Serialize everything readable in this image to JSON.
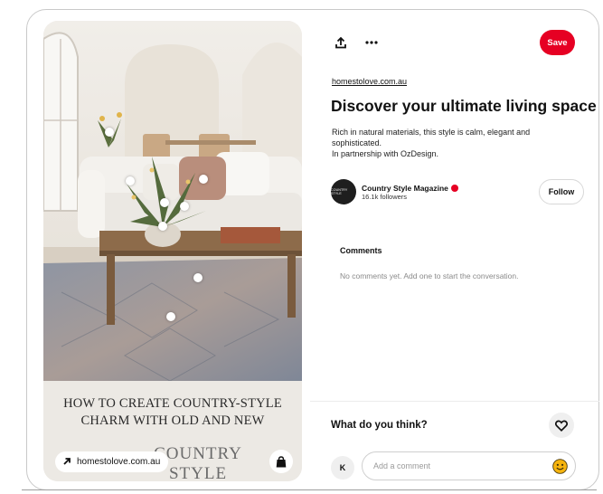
{
  "pin": {
    "headline": "HOW TO CREATE COUNTRY-STYLE CHARM WITH OLD AND NEW",
    "brand_logo_text": "COUNTRY STYLE",
    "link_text": "homestolove.com.au",
    "link_icon": "arrow-up-right-icon",
    "shop_icon": "shopping-bag-icon"
  },
  "toolbar": {
    "share_icon": "share-icon",
    "more_icon": "more-icon",
    "save_label": "Save"
  },
  "source_link": "homestolove.com.au",
  "title": "Discover your ultimate living space",
  "description_lines": [
    "Rich in natural materials, this style is calm, elegant and sophisticated.",
    "In partnership with OzDesign."
  ],
  "profile": {
    "avatar_text": "COUNTRY STYLE",
    "name": "Country Style Magazine",
    "followers": "16.1k followers",
    "follow_label": "Follow"
  },
  "comments": {
    "title": "Comments",
    "empty_text": "No comments yet. Add one to start the conversation."
  },
  "composer": {
    "prompt": "What do you think?",
    "heart_icon": "heart-icon",
    "user_initial": "K",
    "placeholder": "Add a comment",
    "emoji_icon": "smiley-icon"
  },
  "colors": {
    "accent": "#e60023",
    "emoji": "#f6b40e"
  }
}
